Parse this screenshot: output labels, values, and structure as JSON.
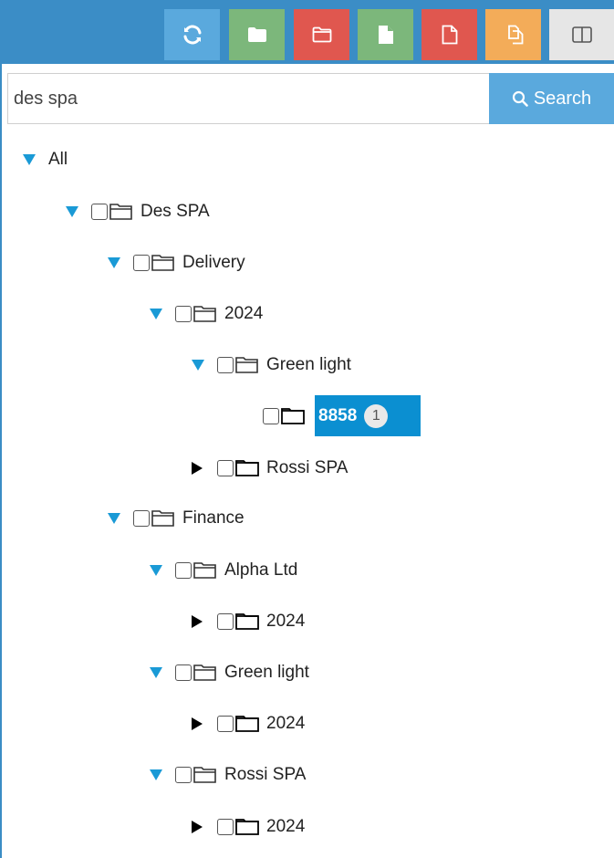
{
  "toolbar": {
    "buttons": [
      {
        "icon": "refresh-icon",
        "color": "#5aa9dd"
      },
      {
        "icon": "folder-add-icon",
        "color": "#7cb77b"
      },
      {
        "icon": "folder-delete-icon",
        "color": "#e0574f"
      },
      {
        "icon": "file-add-icon",
        "color": "#7cb77b"
      },
      {
        "icon": "file-delete-icon",
        "color": "#e0574f"
      },
      {
        "icon": "copy-icon",
        "color": "#f3ac59"
      },
      {
        "icon": "split-view-icon",
        "color": "#e6e6e6"
      }
    ]
  },
  "search": {
    "value": "des spa",
    "button_label": "Search"
  },
  "tree": {
    "root": "All",
    "des_spa": "Des SPA",
    "delivery": "Delivery",
    "delivery_2024": "2024",
    "green_light": "Green light",
    "item_8858": "8858",
    "item_8858_count": "1",
    "rossi_spa_1": "Rossi SPA",
    "finance": "Finance",
    "alpha_ltd": "Alpha Ltd",
    "alpha_2024": "2024",
    "fin_green_light": "Green light",
    "fin_green_2024": "2024",
    "fin_rossi_spa": "Rossi SPA",
    "fin_rossi_2024": "2024"
  }
}
